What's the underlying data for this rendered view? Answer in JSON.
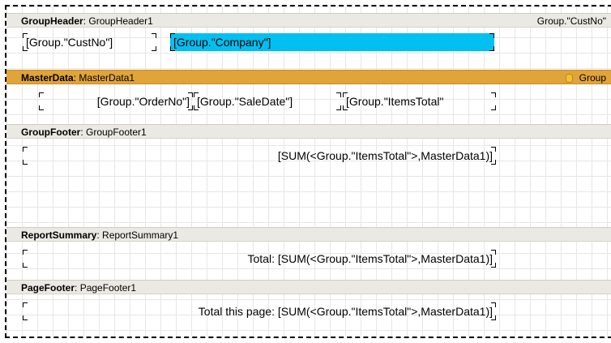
{
  "group_header": {
    "type": "GroupHeader",
    "name": "GroupHeader1",
    "condition": "Group.\"CustNo\"",
    "fields": [
      "[Group.\"CustNo\"]",
      "[Group.\"Company\"]"
    ]
  },
  "master_data": {
    "type": "MasterData",
    "name": "MasterData1",
    "dataset": "Group",
    "fields": [
      "[Group.\"OrderNo\"]",
      "[Group.\"SaleDate\"]",
      "[Group.\"ItemsTotal\""
    ]
  },
  "group_footer": {
    "type": "GroupFooter",
    "name": "GroupFooter1",
    "field": "[SUM(<Group.\"ItemsTotal\">,MasterData1)]"
  },
  "report_summary": {
    "type": "ReportSummary",
    "name": "ReportSummary1",
    "field": "Total: [SUM(<Group.\"ItemsTotal\">,MasterData1)]"
  },
  "page_footer": {
    "type": "PageFooter",
    "name": "PageFooter1",
    "field": "Total this page: [SUM(<Group.\"ItemsTotal\">,MasterData1)]"
  },
  "colors": {
    "highlight": "#00c0f0",
    "master_band": "#e0a43a",
    "band_header": "#ebe9e3"
  }
}
